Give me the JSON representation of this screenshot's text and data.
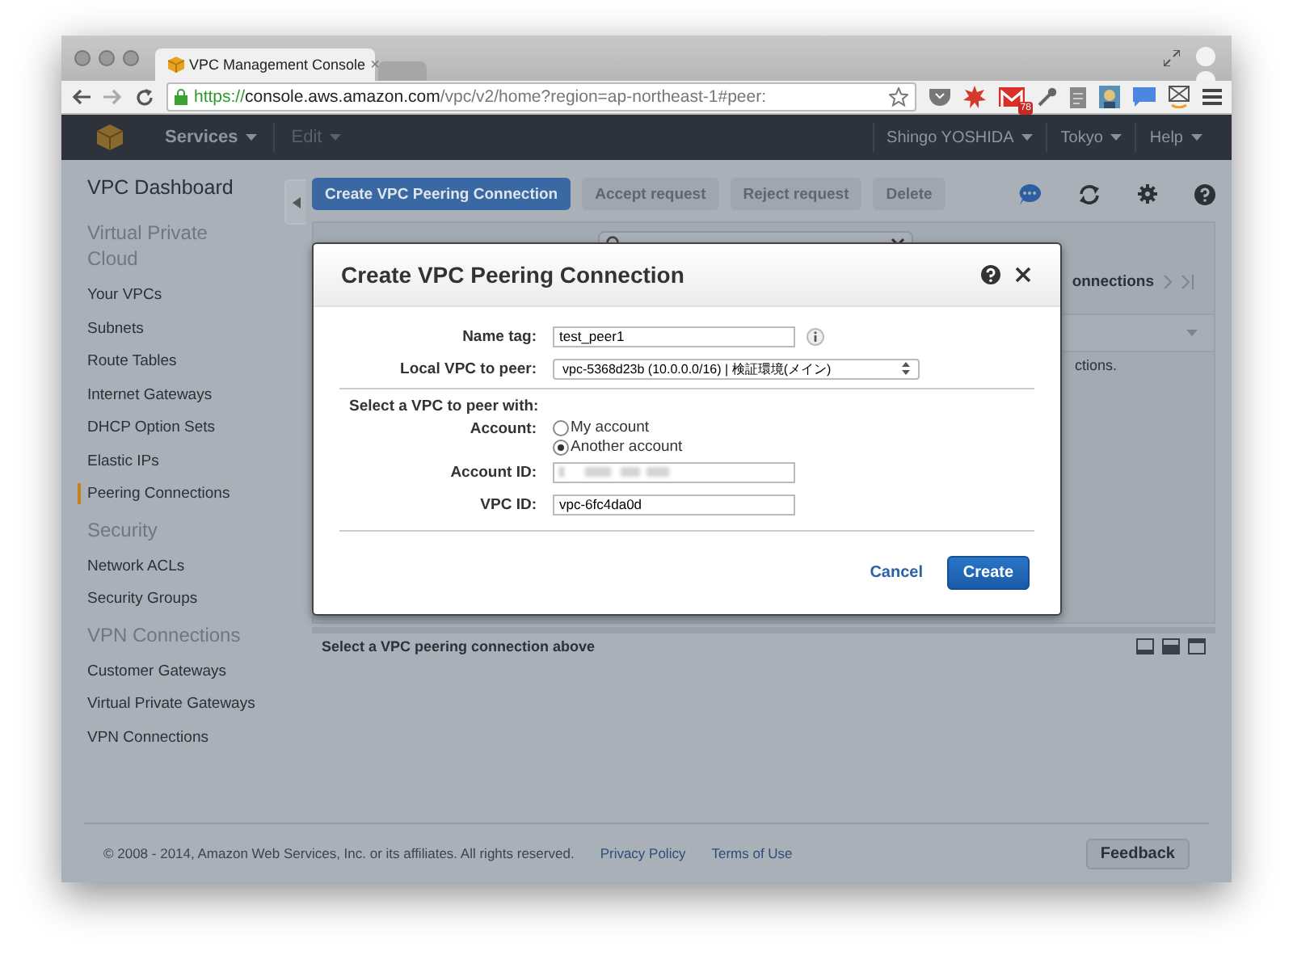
{
  "browser": {
    "tabs": [
      {
        "title": "VPC Management Console",
        "close": "×",
        "selected": true
      },
      {
        "selected": false
      }
    ],
    "url": {
      "scheme": "https://",
      "host": "console.aws.amazon.com",
      "path": "/vpc/v2/home?region=ap-northeast-1#peer:"
    },
    "mail_badge": "78"
  },
  "nav": {
    "left": [
      {
        "label": "Services",
        "disabled": false
      },
      {
        "label": "Edit",
        "disabled": true
      }
    ],
    "right": [
      "Shingo YOSHIDA",
      "Tokyo",
      "Help"
    ]
  },
  "sidebar": {
    "title": "VPC Dashboard",
    "sections": [
      {
        "heading": "Virtual Private Cloud",
        "items": [
          {
            "label": "Your VPCs",
            "selected": false
          },
          {
            "label": "Subnets",
            "selected": false
          },
          {
            "label": "Route Tables",
            "selected": false
          },
          {
            "label": "Internet Gateways",
            "selected": false
          },
          {
            "label": "DHCP Option Sets",
            "selected": false
          },
          {
            "label": "Elastic IPs",
            "selected": false
          },
          {
            "label": "Peering Connections",
            "selected": true
          }
        ]
      },
      {
        "heading": "Security",
        "items": [
          {
            "label": "Network ACLs",
            "selected": false
          },
          {
            "label": "Security Groups",
            "selected": false
          }
        ]
      },
      {
        "heading": "VPN Connections",
        "items": [
          {
            "label": "Customer Gateways",
            "selected": false
          },
          {
            "label": "Virtual Private Gateways",
            "selected": false
          },
          {
            "label": "VPN Connections",
            "selected": false
          }
        ]
      }
    ]
  },
  "toolbar": [
    {
      "label": "Create VPC Peering Connection",
      "disabled": false
    },
    {
      "label": "Accept request",
      "disabled": true
    },
    {
      "label": "Reject request",
      "disabled": true
    },
    {
      "label": "Delete",
      "disabled": true
    }
  ],
  "panel": {
    "pager_text": "onnections",
    "table_note": "ctions."
  },
  "details": {
    "message": "Select a VPC peering connection above"
  },
  "dialog": {
    "title": "Create VPC Peering Connection",
    "rows": [
      {
        "kind": "text",
        "label": "Name tag:",
        "value": "test_peer1",
        "info": true
      },
      {
        "kind": "select",
        "label": "Local VPC to peer:",
        "value": "vpc-5368d23b (10.0.0.0/16) | 検証環境(メイン)"
      },
      {
        "kind": "section",
        "label": "Select a VPC to peer with:"
      },
      {
        "kind": "radio",
        "label": "Account:",
        "options": [
          {
            "label": "My account",
            "selected": false
          },
          {
            "label": "Another account",
            "selected": true
          }
        ]
      },
      {
        "kind": "redacted",
        "label": "Account ID:"
      },
      {
        "kind": "text",
        "label": "VPC ID:",
        "value": "vpc-6fc4da0d",
        "info": false
      }
    ],
    "cancel": "Cancel",
    "confirm": "Create"
  },
  "footer": {
    "copyright": "© 2008 - 2014, Amazon Web Services, Inc. or its affiliates. All rights reserved.",
    "links": [
      "Privacy Policy",
      "Terms of Use"
    ],
    "feedback": "Feedback"
  }
}
